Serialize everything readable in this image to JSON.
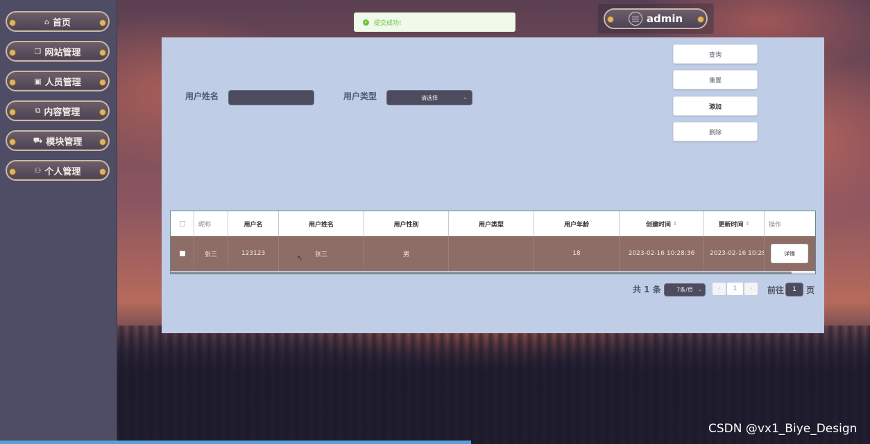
{
  "sidebar": {
    "items": [
      {
        "icon": "home-icon",
        "glyph": "⌂",
        "label": "首页"
      },
      {
        "icon": "window-icon",
        "glyph": "❐",
        "label": "网站管理"
      },
      {
        "icon": "user-card-icon",
        "glyph": "▣",
        "label": "人员管理"
      },
      {
        "icon": "copy-icon",
        "glyph": "⧉",
        "label": "内容管理"
      },
      {
        "icon": "cart-icon",
        "glyph": "⛟",
        "label": "模块管理"
      },
      {
        "icon": "people-icon",
        "glyph": "⚇",
        "label": "个人管理"
      }
    ]
  },
  "toast": {
    "icon": "success-check-icon",
    "text": "提交成功!"
  },
  "header": {
    "username": "admin",
    "icon": "menu-icon"
  },
  "search": {
    "name_label": "用户姓名",
    "name_value": "",
    "type_label": "用户类型",
    "type_placeholder": "请选择"
  },
  "actions": {
    "query": "查询",
    "reset": "重置",
    "add": "添加",
    "delete": "删除"
  },
  "table": {
    "columns": [
      "昵称",
      "用户名",
      "用户姓名",
      "用户性别",
      "用户类型",
      "用户年龄",
      "创建时间",
      "更新时间",
      "操作"
    ],
    "sortable": [
      "创建时间",
      "更新时间"
    ],
    "rows": [
      {
        "nickname": "张三",
        "username": "123123",
        "realname": "张三",
        "gender": "男",
        "usertype": "",
        "age": "18",
        "created": "2023-02-16 10:28:36",
        "updated": "2023-02-16 10:28",
        "action": "详情"
      }
    ]
  },
  "pagination": {
    "total_text": "共 1 条",
    "page_size": "7条/页",
    "current_page": "1",
    "goto_label": "前往",
    "goto_value": "1",
    "page_suffix": "页"
  },
  "watermark": "CSDN @vx1_Biye_Design",
  "colors": {
    "sidebar": "#4f4c66",
    "panel": "#bfcde6",
    "row": "#8d6d66",
    "toast_bg": "#f0f9eb",
    "toast_text": "#67c23a",
    "accent_blue": "#409eff"
  }
}
